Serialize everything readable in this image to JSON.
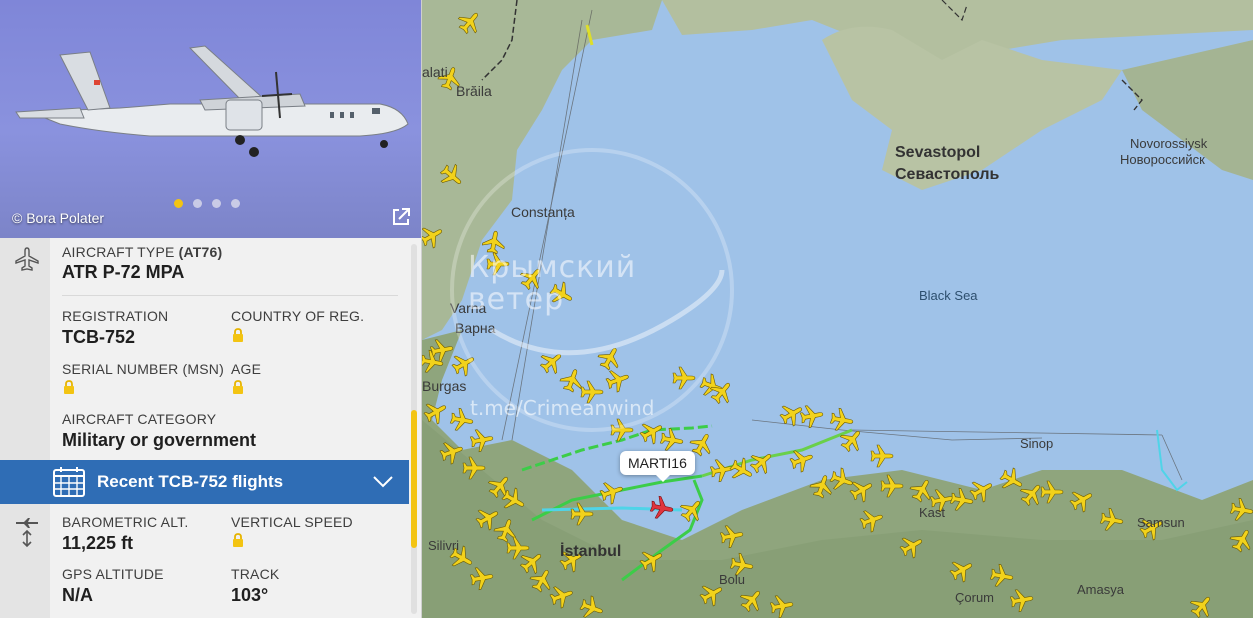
{
  "photo": {
    "credit": "© Bora Polater",
    "carousel_dots": 4,
    "active_dot": 1
  },
  "details": {
    "aircraft_type_label": "AIRCRAFT TYPE",
    "aircraft_type_code": "(AT76)",
    "aircraft_type_value": "ATR P-72 MPA",
    "registration_label": "REGISTRATION",
    "registration_value": "TCB-752",
    "country_label": "COUNTRY OF REG.",
    "serial_label": "SERIAL NUMBER (MSN)",
    "age_label": "AGE",
    "category_label": "AIRCRAFT CATEGORY",
    "category_value": "Military or government",
    "recent_flights_label": "Recent TCB-752 flights",
    "baro_alt_label": "BAROMETRIC ALT.",
    "baro_alt_value": "11,225 ft",
    "vspeed_label": "VERTICAL SPEED",
    "gps_alt_label": "GPS ALTITUDE",
    "gps_alt_value": "N/A",
    "track_label": "TRACK",
    "track_value": "103°"
  },
  "map": {
    "places": {
      "braila": "Brăila",
      "galati": "alati",
      "constanta": "Constanța",
      "varna_latin": "Varna",
      "varna_cyr": "Варна",
      "burgas": "Burgas",
      "sevastopol_latin": "Sevastopol",
      "sevastopol_cyr": "Севастополь",
      "novorossiysk_latin": "Novorossiysk",
      "novorossiysk_cyr": "Новороссийск",
      "black_sea": "Black Sea",
      "sinop": "Sinop",
      "silivri": "Silivri",
      "istanbul": "İstanbul",
      "bolu": "Bolu",
      "amasya": "Amasya",
      "corum": "Çorum",
      "samsun": "Samsun",
      "kastamonu": "Kast"
    },
    "watermark_line1": "Крымский",
    "watermark_line2": "ветер",
    "watermark_link": "t.me/Crimeanwind",
    "selected_flight": "MARTI16",
    "colors": {
      "sea": "#9fc2e8",
      "land": "#a9b99a",
      "aircraft": "#f2d21b",
      "selected_aircraft": "#e0343d",
      "trail_green": "#3ccd48",
      "trail_cyan": "#4fd4e8"
    }
  }
}
